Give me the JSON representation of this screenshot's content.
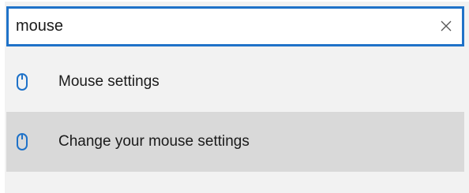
{
  "search": {
    "value": "mouse",
    "clear_icon": "close-icon"
  },
  "results": [
    {
      "label": "Mouse settings",
      "icon": "mouse-icon",
      "selected": false
    },
    {
      "label": "Change your mouse settings",
      "icon": "mouse-icon",
      "selected": true
    }
  ],
  "colors": {
    "accent": "#1f72c8",
    "icon": "#1f72c8",
    "selected_background": "#d9d9d9",
    "panel_background": "#f2f2f2"
  }
}
